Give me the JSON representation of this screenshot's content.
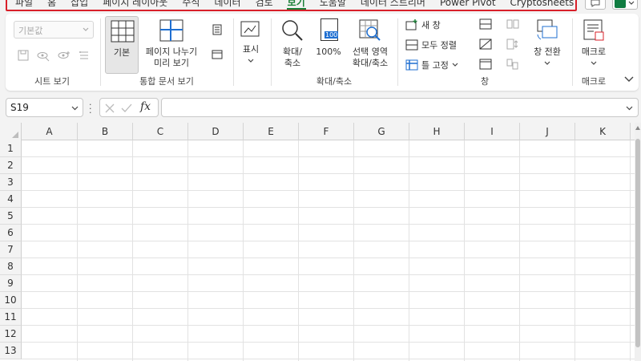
{
  "tabs": [
    {
      "label": "파일",
      "active": false
    },
    {
      "label": "홈",
      "active": false
    },
    {
      "label": "삽입",
      "active": false
    },
    {
      "label": "페이지 레이아웃",
      "active": false
    },
    {
      "label": "수식",
      "active": false
    },
    {
      "label": "데이터",
      "active": false
    },
    {
      "label": "검토",
      "active": false
    },
    {
      "label": "보기",
      "active": true
    },
    {
      "label": "도움말",
      "active": false
    },
    {
      "label": "데이터 스트리머",
      "active": false
    },
    {
      "label": "Power Pivot",
      "active": false
    },
    {
      "label": "Cryptosheets",
      "active": false
    }
  ],
  "ribbon": {
    "sheet_view": {
      "dropdown_value": "기본값",
      "label": "시트 보기"
    },
    "workbook_views": {
      "normal": "기본",
      "page_break_line1": "페이지 나누기",
      "page_break_line2": "미리 보기",
      "label": "통합 문서 보기"
    },
    "show": {
      "label": "표시"
    },
    "zoom": {
      "zoom_line1": "확대/",
      "zoom_line2": "축소",
      "zoom100": "100%",
      "zoom_sel_line1": "선택 영역",
      "zoom_sel_line2": "확대/축소",
      "label": "확대/축소",
      "badge": "100"
    },
    "window": {
      "new_window": "새 창",
      "arrange_all": "모두 정렬",
      "freeze_panes": "틀 고정",
      "switch_windows": "창 전환",
      "label": "창"
    },
    "macros": {
      "macro": "매크로",
      "label": "매크로"
    }
  },
  "formula_bar": {
    "name_box": "S19",
    "fx": "fx",
    "value": ""
  },
  "columns": [
    "A",
    "B",
    "C",
    "D",
    "E",
    "F",
    "G",
    "H",
    "I",
    "J",
    "K"
  ],
  "rows": [
    "1",
    "2",
    "3",
    "4",
    "5",
    "6",
    "7",
    "8",
    "9",
    "10",
    "11",
    "12",
    "13"
  ],
  "colors": {
    "accent": "#1a7f37",
    "highlight": "#d9202a",
    "excel_green": "#107c41"
  }
}
